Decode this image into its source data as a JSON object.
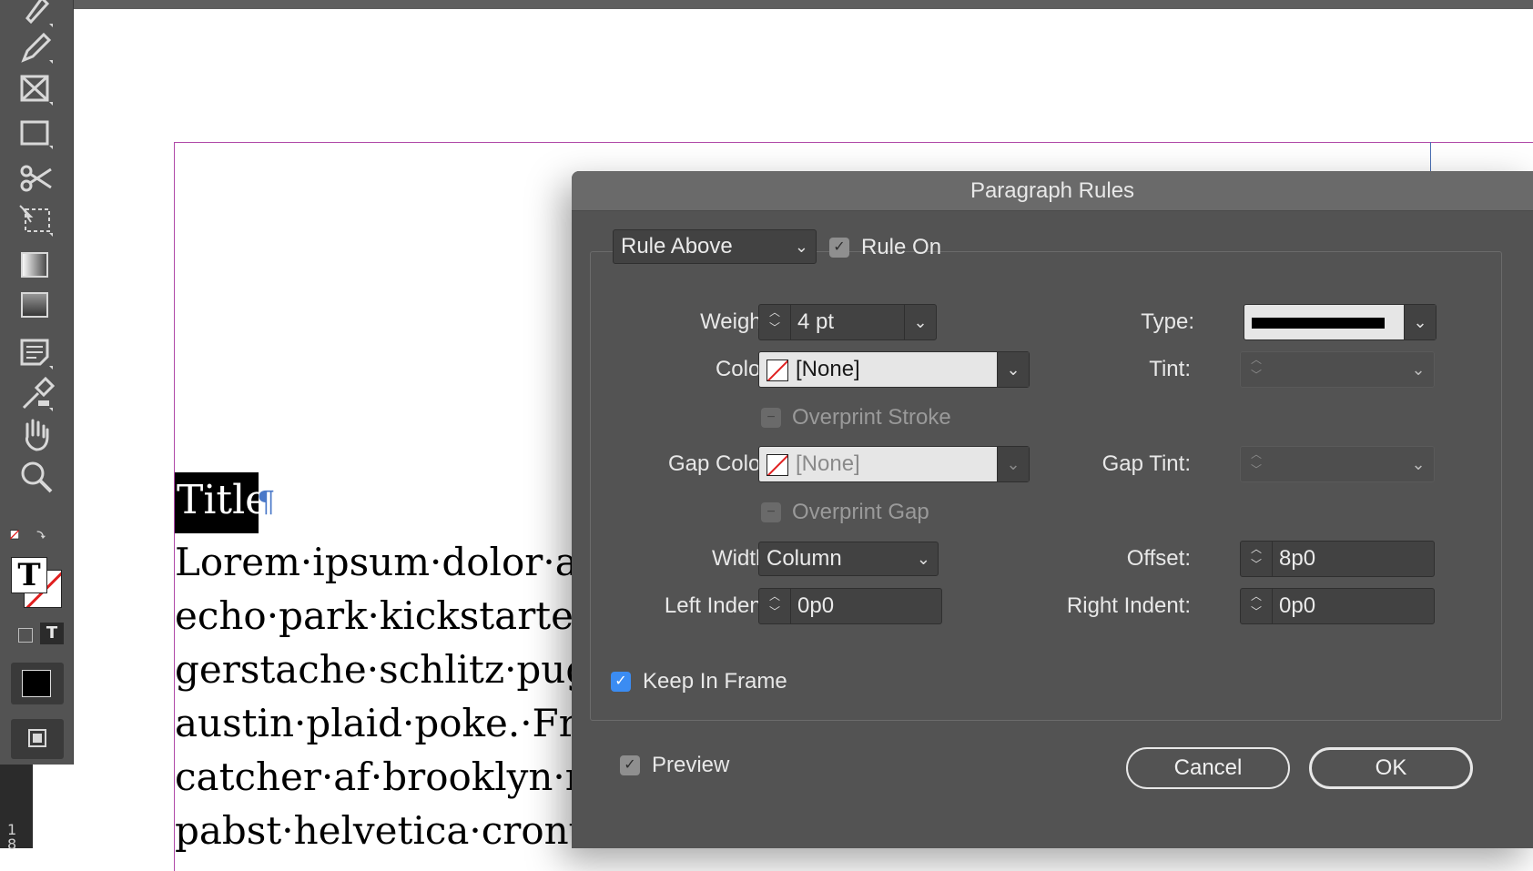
{
  "document": {
    "title_text": "Title",
    "pilcrow": "¶",
    "body_lines": [
      "Lorem·ipsum·dolor·am",
      "echo·park·kickstarter·c",
      "gerstache·schlitz·pug·a",
      "austin·plaid·poke.·Free",
      "catcher·af·brooklyn·ma",
      "pabst·helvetica·cronut."
    ],
    "ruler_label": [
      "1",
      "8"
    ]
  },
  "toolbar": {
    "tools": [
      "pen-tool-icon",
      "pencil-icon",
      "rectangle-frame-icon",
      "rectangle-icon",
      "scissors-icon",
      "free-transform-icon",
      "gradient-swatch-icon",
      "gradient-feather-icon",
      "note-icon",
      "eyedropper-icon",
      "hand-icon",
      "zoom-icon"
    ],
    "fill_stroke_letter": "T",
    "format_text_letter": "T"
  },
  "dialog": {
    "title": "Paragraph Rules",
    "rule_select": "Rule Above",
    "rule_on_label": "Rule On",
    "rule_on_checked": true,
    "weight": {
      "label": "Weight:",
      "value": "4 pt"
    },
    "type": {
      "label": "Type:",
      "value": "solid"
    },
    "color": {
      "label": "Color:",
      "value": "[None]"
    },
    "tint": {
      "label": "Tint:",
      "value": ""
    },
    "overprint_stroke_label": "Overprint Stroke",
    "gap_color": {
      "label": "Gap Color:",
      "value": "[None]"
    },
    "gap_tint": {
      "label": "Gap Tint:",
      "value": ""
    },
    "overprint_gap_label": "Overprint Gap",
    "width": {
      "label": "Width:",
      "value": "Column"
    },
    "offset": {
      "label": "Offset:",
      "value": "8p0"
    },
    "left_indent": {
      "label": "Left Indent:",
      "value": "0p0"
    },
    "right_indent": {
      "label": "Right Indent:",
      "value": "0p0"
    },
    "keep_in_frame_label": "Keep In Frame",
    "keep_in_frame_checked": true,
    "preview_label": "Preview",
    "preview_checked": true,
    "cancel_label": "Cancel",
    "ok_label": "OK",
    "colors": {
      "dialog_bg": "#535353",
      "accent_blue": "#3b8cf2",
      "none_swatch_red": "#e02020"
    }
  }
}
